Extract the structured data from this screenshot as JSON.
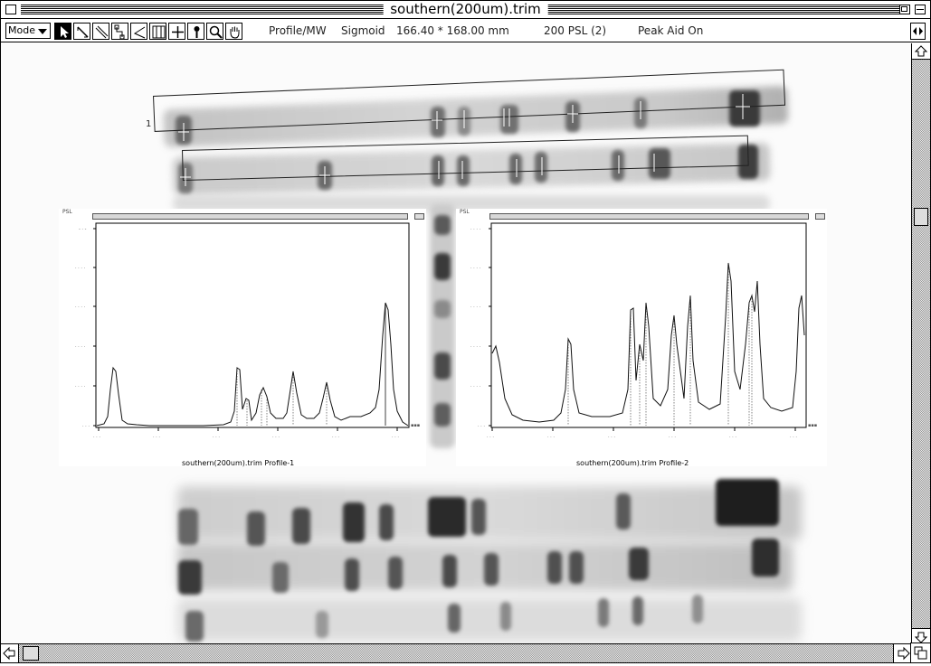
{
  "window": {
    "title": "southern(200um).trim"
  },
  "toolbar": {
    "mode_label": "Mode",
    "tools": [
      {
        "name": "arrow-tool-icon",
        "selected": true
      },
      {
        "name": "line-tool-icon",
        "selected": false
      },
      {
        "name": "diagonal-line-tool-icon",
        "selected": false
      },
      {
        "name": "polyline-tool-icon",
        "selected": false
      },
      {
        "name": "angle-tool-icon",
        "selected": false
      },
      {
        "name": "lane-tool-icon",
        "selected": false
      },
      {
        "name": "crosshair-tool-icon",
        "selected": false
      },
      {
        "name": "pin-tool-icon",
        "selected": false
      },
      {
        "name": "magnifier-tool-icon",
        "selected": false
      },
      {
        "name": "hand-tool-icon",
        "selected": false
      }
    ],
    "profile_label": "Profile/MW",
    "fit_label": "Sigmoid",
    "dimensions": "166.40 * 168.00 mm",
    "psl_label": "200  PSL (2)",
    "peak_aid_label": "Peak Aid On"
  },
  "gel": {
    "lane_labels": [
      "1"
    ]
  },
  "plots": [
    {
      "caption": "southern(200um).trim Profile-1",
      "unit_label": "PSL"
    },
    {
      "caption": "southern(200um).trim Profile-2",
      "unit_label": "PSL"
    }
  ],
  "colors": {
    "band_dark": "#2a2a2a",
    "lane_bg": "#c8c8c8",
    "plot_line": "#111111"
  }
}
